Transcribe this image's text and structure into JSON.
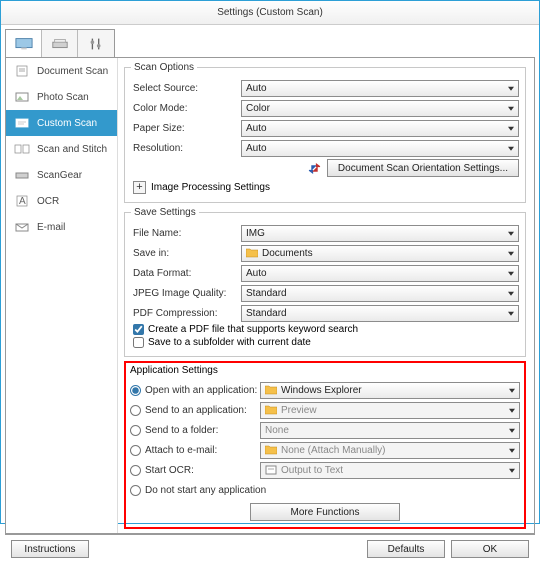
{
  "title": "Settings (Custom Scan)",
  "sidebar": {
    "items": [
      {
        "label": "Document Scan"
      },
      {
        "label": "Photo Scan"
      },
      {
        "label": "Custom Scan"
      },
      {
        "label": "Scan and Stitch"
      },
      {
        "label": "ScanGear"
      },
      {
        "label": "OCR"
      },
      {
        "label": "E-mail"
      }
    ]
  },
  "scan_options": {
    "legend": "Scan Options",
    "select_source_label": "Select Source:",
    "select_source_value": "Auto",
    "color_mode_label": "Color Mode:",
    "color_mode_value": "Color",
    "paper_size_label": "Paper Size:",
    "paper_size_value": "Auto",
    "resolution_label": "Resolution:",
    "resolution_value": "Auto",
    "orientation_btn": "Document Scan Orientation Settings...",
    "image_processing_label": "Image Processing Settings"
  },
  "save_settings": {
    "legend": "Save Settings",
    "file_name_label": "File Name:",
    "file_name_value": "IMG",
    "save_in_label": "Save in:",
    "save_in_value": "Documents",
    "data_format_label": "Data Format:",
    "data_format_value": "Auto",
    "jpeg_quality_label": "JPEG Image Quality:",
    "jpeg_quality_value": "Standard",
    "pdf_compression_label": "PDF Compression:",
    "pdf_compression_value": "Standard",
    "pdf_keyword_label": "Create a PDF file that supports keyword search",
    "subfolder_label": "Save to a subfolder with current date"
  },
  "app_settings": {
    "legend": "Application Settings",
    "open_app_label": "Open with an application:",
    "open_app_value": "Windows Explorer",
    "send_app_label": "Send to an application:",
    "send_app_value": "Preview",
    "send_folder_label": "Send to a folder:",
    "send_folder_value": "None",
    "attach_email_label": "Attach to e-mail:",
    "attach_email_value": "None (Attach Manually)",
    "start_ocr_label": "Start OCR:",
    "start_ocr_value": "Output to Text",
    "do_not_start_label": "Do not start any application",
    "more_functions": "More Functions"
  },
  "footer": {
    "instructions": "Instructions",
    "defaults": "Defaults",
    "ok": "OK"
  }
}
